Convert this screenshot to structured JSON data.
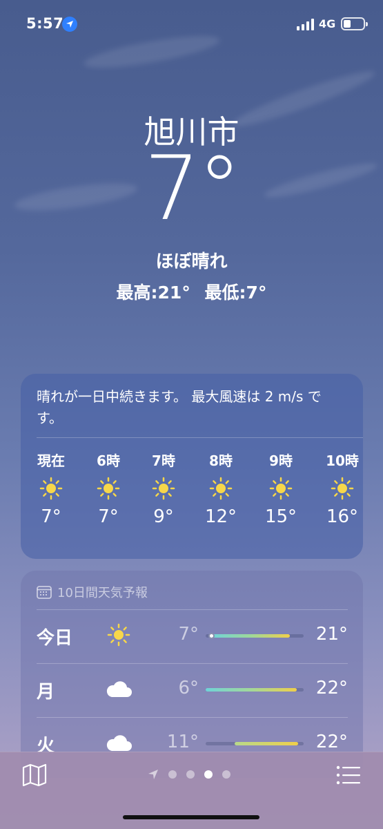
{
  "status_bar": {
    "time": "5:57",
    "network": "4G"
  },
  "header": {
    "city": "旭川市",
    "temperature": "7°",
    "condition": "ほぼ晴れ",
    "high": "最高:21°",
    "low": "最低:7°"
  },
  "hourly": {
    "summary": "晴れが一日中続きます。 最大風速は 2 m/s です。",
    "hours": [
      {
        "label": "現在",
        "icon": "sun-icon",
        "temp": "7°"
      },
      {
        "label": "6時",
        "icon": "sun-icon",
        "temp": "7°"
      },
      {
        "label": "7時",
        "icon": "sun-icon",
        "temp": "9°"
      },
      {
        "label": "8時",
        "icon": "sun-icon",
        "temp": "12°"
      },
      {
        "label": "9時",
        "icon": "sun-icon",
        "temp": "15°"
      },
      {
        "label": "10時",
        "icon": "sun-icon",
        "temp": "16°"
      }
    ]
  },
  "forecast": {
    "title": "10日間天気予報",
    "days": [
      {
        "day": "今日",
        "icon": "sun-icon",
        "low": "7°",
        "high": "21°"
      },
      {
        "day": "月",
        "icon": "cloud-icon",
        "low": "6°",
        "high": "22°"
      },
      {
        "day": "火",
        "icon": "cloud-icon",
        "low": "11°",
        "high": "22°"
      }
    ]
  },
  "pager": {
    "pages": 4,
    "active_index": 2
  },
  "colors": {
    "sun": "#f7d74a",
    "location_blue": "#2f80ff",
    "bar_cool": "#6fd3d8",
    "bar_warm": "#f0cf4a"
  }
}
